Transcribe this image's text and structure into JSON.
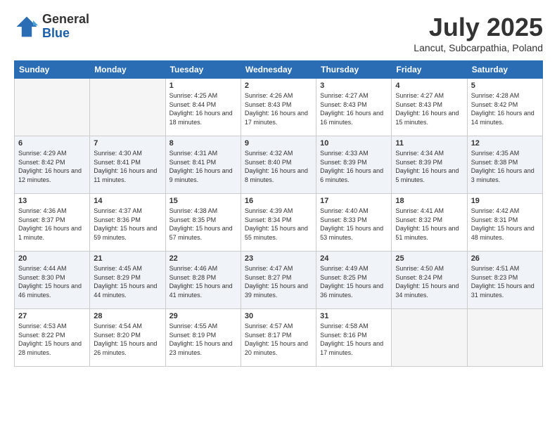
{
  "logo": {
    "general": "General",
    "blue": "Blue"
  },
  "title": "July 2025",
  "subtitle": "Lancut, Subcarpathia, Poland",
  "days_of_week": [
    "Sunday",
    "Monday",
    "Tuesday",
    "Wednesday",
    "Thursday",
    "Friday",
    "Saturday"
  ],
  "weeks": [
    [
      {
        "day": "",
        "sunrise": "",
        "sunset": "",
        "daylight": ""
      },
      {
        "day": "",
        "sunrise": "",
        "sunset": "",
        "daylight": ""
      },
      {
        "day": "1",
        "sunrise": "Sunrise: 4:25 AM",
        "sunset": "Sunset: 8:44 PM",
        "daylight": "Daylight: 16 hours and 18 minutes."
      },
      {
        "day": "2",
        "sunrise": "Sunrise: 4:26 AM",
        "sunset": "Sunset: 8:43 PM",
        "daylight": "Daylight: 16 hours and 17 minutes."
      },
      {
        "day": "3",
        "sunrise": "Sunrise: 4:27 AM",
        "sunset": "Sunset: 8:43 PM",
        "daylight": "Daylight: 16 hours and 16 minutes."
      },
      {
        "day": "4",
        "sunrise": "Sunrise: 4:27 AM",
        "sunset": "Sunset: 8:43 PM",
        "daylight": "Daylight: 16 hours and 15 minutes."
      },
      {
        "day": "5",
        "sunrise": "Sunrise: 4:28 AM",
        "sunset": "Sunset: 8:42 PM",
        "daylight": "Daylight: 16 hours and 14 minutes."
      }
    ],
    [
      {
        "day": "6",
        "sunrise": "Sunrise: 4:29 AM",
        "sunset": "Sunset: 8:42 PM",
        "daylight": "Daylight: 16 hours and 12 minutes."
      },
      {
        "day": "7",
        "sunrise": "Sunrise: 4:30 AM",
        "sunset": "Sunset: 8:41 PM",
        "daylight": "Daylight: 16 hours and 11 minutes."
      },
      {
        "day": "8",
        "sunrise": "Sunrise: 4:31 AM",
        "sunset": "Sunset: 8:41 PM",
        "daylight": "Daylight: 16 hours and 9 minutes."
      },
      {
        "day": "9",
        "sunrise": "Sunrise: 4:32 AM",
        "sunset": "Sunset: 8:40 PM",
        "daylight": "Daylight: 16 hours and 8 minutes."
      },
      {
        "day": "10",
        "sunrise": "Sunrise: 4:33 AM",
        "sunset": "Sunset: 8:39 PM",
        "daylight": "Daylight: 16 hours and 6 minutes."
      },
      {
        "day": "11",
        "sunrise": "Sunrise: 4:34 AM",
        "sunset": "Sunset: 8:39 PM",
        "daylight": "Daylight: 16 hours and 5 minutes."
      },
      {
        "day": "12",
        "sunrise": "Sunrise: 4:35 AM",
        "sunset": "Sunset: 8:38 PM",
        "daylight": "Daylight: 16 hours and 3 minutes."
      }
    ],
    [
      {
        "day": "13",
        "sunrise": "Sunrise: 4:36 AM",
        "sunset": "Sunset: 8:37 PM",
        "daylight": "Daylight: 16 hours and 1 minute."
      },
      {
        "day": "14",
        "sunrise": "Sunrise: 4:37 AM",
        "sunset": "Sunset: 8:36 PM",
        "daylight": "Daylight: 15 hours and 59 minutes."
      },
      {
        "day": "15",
        "sunrise": "Sunrise: 4:38 AM",
        "sunset": "Sunset: 8:35 PM",
        "daylight": "Daylight: 15 hours and 57 minutes."
      },
      {
        "day": "16",
        "sunrise": "Sunrise: 4:39 AM",
        "sunset": "Sunset: 8:34 PM",
        "daylight": "Daylight: 15 hours and 55 minutes."
      },
      {
        "day": "17",
        "sunrise": "Sunrise: 4:40 AM",
        "sunset": "Sunset: 8:33 PM",
        "daylight": "Daylight: 15 hours and 53 minutes."
      },
      {
        "day": "18",
        "sunrise": "Sunrise: 4:41 AM",
        "sunset": "Sunset: 8:32 PM",
        "daylight": "Daylight: 15 hours and 51 minutes."
      },
      {
        "day": "19",
        "sunrise": "Sunrise: 4:42 AM",
        "sunset": "Sunset: 8:31 PM",
        "daylight": "Daylight: 15 hours and 48 minutes."
      }
    ],
    [
      {
        "day": "20",
        "sunrise": "Sunrise: 4:44 AM",
        "sunset": "Sunset: 8:30 PM",
        "daylight": "Daylight: 15 hours and 46 minutes."
      },
      {
        "day": "21",
        "sunrise": "Sunrise: 4:45 AM",
        "sunset": "Sunset: 8:29 PM",
        "daylight": "Daylight: 15 hours and 44 minutes."
      },
      {
        "day": "22",
        "sunrise": "Sunrise: 4:46 AM",
        "sunset": "Sunset: 8:28 PM",
        "daylight": "Daylight: 15 hours and 41 minutes."
      },
      {
        "day": "23",
        "sunrise": "Sunrise: 4:47 AM",
        "sunset": "Sunset: 8:27 PM",
        "daylight": "Daylight: 15 hours and 39 minutes."
      },
      {
        "day": "24",
        "sunrise": "Sunrise: 4:49 AM",
        "sunset": "Sunset: 8:25 PM",
        "daylight": "Daylight: 15 hours and 36 minutes."
      },
      {
        "day": "25",
        "sunrise": "Sunrise: 4:50 AM",
        "sunset": "Sunset: 8:24 PM",
        "daylight": "Daylight: 15 hours and 34 minutes."
      },
      {
        "day": "26",
        "sunrise": "Sunrise: 4:51 AM",
        "sunset": "Sunset: 8:23 PM",
        "daylight": "Daylight: 15 hours and 31 minutes."
      }
    ],
    [
      {
        "day": "27",
        "sunrise": "Sunrise: 4:53 AM",
        "sunset": "Sunset: 8:22 PM",
        "daylight": "Daylight: 15 hours and 28 minutes."
      },
      {
        "day": "28",
        "sunrise": "Sunrise: 4:54 AM",
        "sunset": "Sunset: 8:20 PM",
        "daylight": "Daylight: 15 hours and 26 minutes."
      },
      {
        "day": "29",
        "sunrise": "Sunrise: 4:55 AM",
        "sunset": "Sunset: 8:19 PM",
        "daylight": "Daylight: 15 hours and 23 minutes."
      },
      {
        "day": "30",
        "sunrise": "Sunrise: 4:57 AM",
        "sunset": "Sunset: 8:17 PM",
        "daylight": "Daylight: 15 hours and 20 minutes."
      },
      {
        "day": "31",
        "sunrise": "Sunrise: 4:58 AM",
        "sunset": "Sunset: 8:16 PM",
        "daylight": "Daylight: 15 hours and 17 minutes."
      },
      {
        "day": "",
        "sunrise": "",
        "sunset": "",
        "daylight": ""
      },
      {
        "day": "",
        "sunrise": "",
        "sunset": "",
        "daylight": ""
      }
    ]
  ]
}
